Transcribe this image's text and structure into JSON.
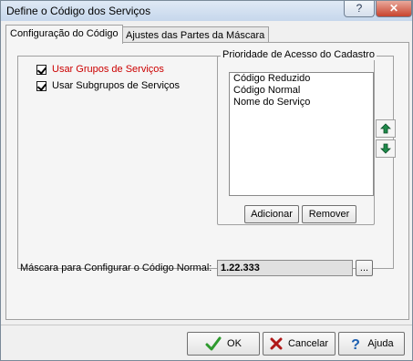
{
  "window": {
    "title": "Define o Código dos Serviços",
    "help_icon": "help-icon",
    "close_icon": "close-icon",
    "help_glyph": "?",
    "close_glyph": "✕"
  },
  "tabs": [
    {
      "label": "Configuração do Código",
      "active": true
    },
    {
      "label": "Ajustes das Partes da Máscara",
      "active": false
    }
  ],
  "options": [
    {
      "label": "Usar Grupos de Serviços",
      "checked": true,
      "color": "#cc0000"
    },
    {
      "label": "Usar Subgrupos de Serviços",
      "checked": true
    }
  ],
  "priority": {
    "group_label": "Prioridade de Acesso do Cadastro",
    "items": [
      "Código Reduzido",
      "Código Normal",
      "Nome do Serviço"
    ],
    "add_label": "Adicionar",
    "remove_label": "Remover",
    "up_icon": "arrow-up-icon",
    "down_icon": "arrow-down-icon"
  },
  "mask": {
    "label": "Máscara para Configurar o Código Normal:",
    "value": "1.22.333",
    "browse_label": "..."
  },
  "footer": {
    "ok_label": "OK",
    "cancel_label": "Cancelar",
    "help_label": "Ajuda",
    "ok_icon": "checkmark-icon",
    "cancel_icon": "x-icon",
    "help_icon": "question-icon"
  },
  "colors": {
    "accent_red": "#cc0000",
    "ok_green": "#2e9a2e",
    "cancel_red": "#b01818",
    "help_blue": "#1c5fb0",
    "arrow_green": "#1e8a4a"
  }
}
